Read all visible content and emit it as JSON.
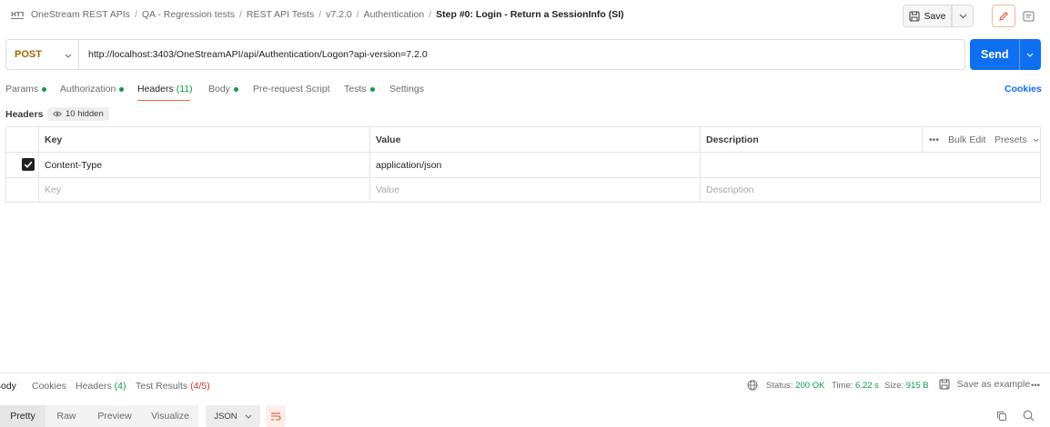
{
  "breadcrumb": {
    "items": [
      "OneStream REST APIs",
      "QA - Regression tests",
      "REST API Tests",
      "v7.2.0",
      "Authentication"
    ],
    "separator": "/",
    "current": "Step #0: Login - Return a SessionInfo (SI)"
  },
  "toolbar": {
    "save_label": "Save"
  },
  "request": {
    "method": "POST",
    "url": "http://localhost:3403/OneStreamAPI/api/Authentication/Logon?api-version=7.2.0",
    "send_label": "Send"
  },
  "tabs": [
    {
      "label": "Params",
      "dot": true
    },
    {
      "label": "Authorization",
      "dot": true
    },
    {
      "label": "Headers",
      "count": "(11)",
      "active": true
    },
    {
      "label": "Body",
      "dot": true
    },
    {
      "label": "Pre-request Script"
    },
    {
      "label": "Tests",
      "dot": true
    },
    {
      "label": "Settings"
    }
  ],
  "cookies_label": "Cookies",
  "headers_section": {
    "title": "Headers",
    "hidden_badge": "10 hidden"
  },
  "table": {
    "columns": [
      "Key",
      "Value",
      "Description"
    ],
    "actions": {
      "bulk_edit": "Bulk Edit",
      "presets": "Presets",
      "more": "•••"
    },
    "rows": [
      {
        "checked": true,
        "key": "Content-Type",
        "value": "application/json",
        "description": ""
      }
    ],
    "placeholders": {
      "key": "Key",
      "value": "Value",
      "description": "Description"
    }
  },
  "response": {
    "tabs": {
      "body": "Body",
      "cookies": "Cookies",
      "headers": "Headers",
      "headers_count": "(4)",
      "tests": "Test Results",
      "tests_count": "(4/5)"
    },
    "status_label": "Status:",
    "status": "200 OK",
    "time_label": "Time:",
    "time": "6.22 s",
    "size_label": "Size:",
    "size": "915 B",
    "save_example": "Save as example",
    "more": "•••",
    "view_modes": [
      "Pretty",
      "Raw",
      "Preview",
      "Visualize"
    ],
    "format": "JSON"
  },
  "colors": {
    "accent_blue": "#0e6ff0",
    "method_post": "#a56700",
    "green": "#0c9c4d",
    "active_tab_underline": "#f26b3a",
    "test_count_red": "#cf3228"
  }
}
